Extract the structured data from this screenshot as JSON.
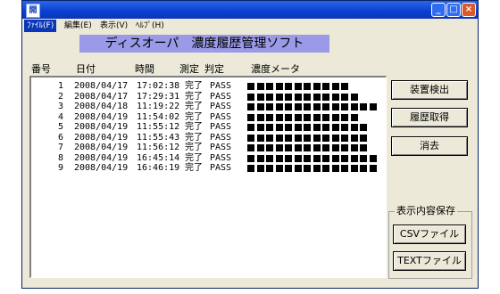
{
  "window": {
    "title_icon_text": "開",
    "controls": {
      "minimize": "_",
      "maximize": "□",
      "close": "×"
    }
  },
  "menu": {
    "items": [
      {
        "label": "ﾌｧｲﾙ(F)",
        "active": true
      },
      {
        "label": "編集(E)",
        "active": false
      },
      {
        "label": "表示(V)",
        "active": false
      },
      {
        "label": "ﾍﾙﾌﾟ(H)",
        "active": false
      }
    ]
  },
  "app_title": "ディスオーパ　濃度履歴管理ソフト",
  "columns": {
    "no": "番号",
    "date": "日付",
    "time": "時間",
    "measure": "測定",
    "judge": "判定",
    "meter": "濃度メータ"
  },
  "records": [
    {
      "no": "1",
      "date": "2008/04/17",
      "time": "17:02:38",
      "result": "完了",
      "judge": "PASS",
      "meter_level": 11
    },
    {
      "no": "2",
      "date": "2008/04/17",
      "time": "17:29:31",
      "result": "完了",
      "judge": "PASS",
      "meter_level": 12
    },
    {
      "no": "3",
      "date": "2008/04/18",
      "time": "11:19:22",
      "result": "完了",
      "judge": "PASS",
      "meter_level": 14
    },
    {
      "no": "4",
      "date": "2008/04/19",
      "time": "11:54:02",
      "result": "完了",
      "judge": "PASS",
      "meter_level": 12
    },
    {
      "no": "5",
      "date": "2008/04/19",
      "time": "11:55:12",
      "result": "完了",
      "judge": "PASS",
      "meter_level": 13
    },
    {
      "no": "6",
      "date": "2008/04/19",
      "time": "11:55:43",
      "result": "完了",
      "judge": "PASS",
      "meter_level": 13
    },
    {
      "no": "7",
      "date": "2008/04/19",
      "time": "11:56:12",
      "result": "完了",
      "judge": "PASS",
      "meter_level": 13
    },
    {
      "no": "8",
      "date": "2008/04/19",
      "time": "16:45:14",
      "result": "完了",
      "judge": "PASS",
      "meter_level": 14
    },
    {
      "no": "9",
      "date": "2008/04/19",
      "time": "16:46:19",
      "result": "完了",
      "judge": "PASS",
      "meter_level": 14
    }
  ],
  "buttons": {
    "detect": "装置検出",
    "history": "履歴取得",
    "clear": "消去"
  },
  "save_group": {
    "label": "表示内容保存",
    "csv": "CSVファイル",
    "text": "TEXTファイル"
  }
}
